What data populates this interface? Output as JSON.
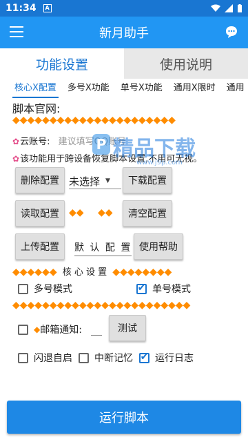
{
  "status": {
    "time": "11:34",
    "notif_glyph": "A"
  },
  "appbar": {
    "title": "新月助手"
  },
  "tabs": [
    {
      "label": "功能设置"
    },
    {
      "label": "使用说明"
    }
  ],
  "subtabs": [
    "核心X配置",
    "多号X功能",
    "单号X功能",
    "通用X限时",
    "通用"
  ],
  "labels": {
    "official_site": "脚本官网:",
    "cloud_account": "云账号:",
    "cloud_placeholder": "建议填写QQ账号",
    "note": "该功能用于跨设备恢复脚本设置,不用可无视。",
    "core_settings": "核 心 设 置",
    "mail_notify": "邮箱通知:",
    "default_config": "默 认 配 置"
  },
  "diamond_rows": {
    "row1": "◆◆◆◆◆◆◆◆◆◆◆◆◆◆◆◆◆◆◆◆◆◆",
    "pair": "◆◆",
    "core_left": "◆◆◆◆◆◆",
    "core_right": "◆◆◆◆◆◆◆◆",
    "row2": "◆◆◆◆◆◆◆◆◆◆◆◆◆◆◆◆◆◆◆◆◆◆◆◆",
    "single": "◆"
  },
  "buttons": {
    "delete_config": "删除配置",
    "download_config": "下载配置",
    "read_config": "读取配置",
    "clear_config": "清空配置",
    "upload_config": "上传配置",
    "help": "使用帮助",
    "test": "测试",
    "run": "运行脚本"
  },
  "select": {
    "value": "未选择"
  },
  "checkboxes": {
    "multi_mode": {
      "label": "多号模式",
      "checked": false
    },
    "single_mode": {
      "label": "单号模式",
      "checked": true
    },
    "mail": {
      "label": "",
      "checked": false
    },
    "crash_restart": {
      "label": "闪退自启",
      "checked": false
    },
    "resume_memory": {
      "label": "中断记忆",
      "checked": false
    },
    "run_log": {
      "label": "运行日志",
      "checked": true
    }
  },
  "watermark": {
    "text": "精品下载",
    "url": "www.j9p.com"
  },
  "colors": {
    "primary": "#2196f3",
    "statusbar": "#1976d2",
    "accent": "#ff8c00"
  }
}
